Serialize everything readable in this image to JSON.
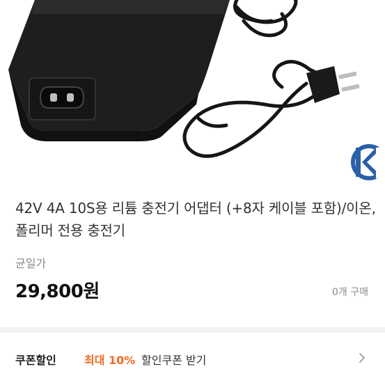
{
  "product": {
    "title": "42V 4A 10S용 리튬 충전기 어댑터 (+8자 케이블 포함)/이온,폴리머 전용 충전기",
    "price_label": "균일가",
    "price": "29,800원",
    "purchase_count": "0개 구매"
  },
  "coupon": {
    "label": "쿠폰할인",
    "max_discount": "최대 10%",
    "text": "할인쿠폰 받기"
  },
  "image": {
    "icons": [
      "charger-adapter-image",
      "power-cable-image",
      "kc-mark-icon"
    ]
  },
  "colors": {
    "accent": "#f36b21",
    "divider": "#f2f2f2"
  }
}
